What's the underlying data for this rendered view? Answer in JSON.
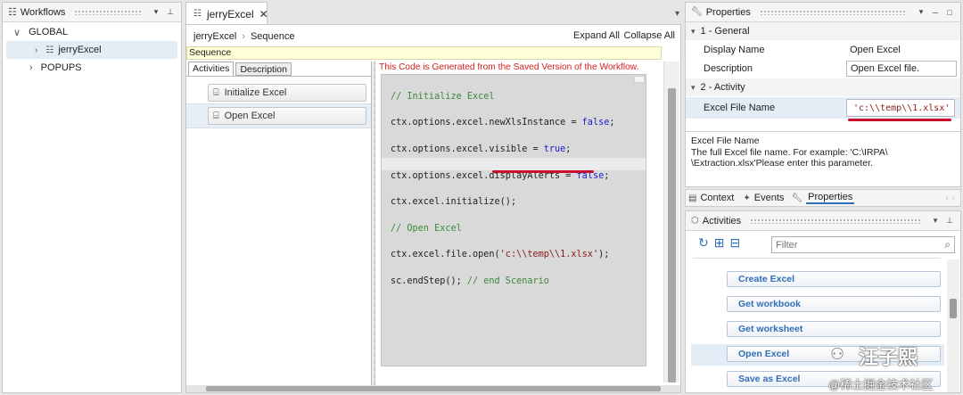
{
  "workflows": {
    "title": "Workflows",
    "items": [
      {
        "label": "GLOBAL"
      },
      {
        "label": "jerryExcel"
      },
      {
        "label": "POPUPS"
      }
    ]
  },
  "editor": {
    "tab_label": "jerryExcel",
    "breadcrumb": {
      "root": "jerryExcel",
      "child": "Sequence"
    },
    "expand_all": "Expand All",
    "collapse_all": "Collapse All",
    "sequence_label": "Sequence",
    "tabs": [
      "Activities",
      "Description"
    ],
    "activities": [
      "Initialize Excel",
      "Open Excel"
    ],
    "code_banner": "This Code is Generated from the Saved Version of the Workflow.",
    "code": {
      "l1": "// Initialize Excel",
      "l2a": "ctx.options.excel.newXlsInstance = ",
      "l2b": "false",
      "l3a": "ctx.options.excel.visible = ",
      "l3b": "true",
      "l4a": "ctx.options.excel.displayAlerts = ",
      "l4b": "false",
      "l5": "ctx.excel.initialize();",
      "l6": "// Open Excel",
      "l7a": "ctx.excel.file.open(",
      "l7b": "'c:\\\\temp\\\\1.xlsx'",
      "l7c": ");",
      "l8a": "sc.endStep(); ",
      "l8b": "// end Scenario"
    },
    "semicolon": ";"
  },
  "properties": {
    "title": "Properties",
    "sections": [
      {
        "label": "1 - General"
      },
      {
        "label": "2 - Activity"
      }
    ],
    "display_name_label": "Display Name",
    "display_name_value": "Open Excel",
    "description_label": "Description",
    "description_value": "Open Excel file.",
    "excel_file_name_label": "Excel File Name",
    "excel_file_name_value": "'c:\\\\temp\\\\1.xlsx'",
    "help_title": "Excel File Name",
    "help_text_1": "The full Excel file name. For example: 'C:\\IRPA\\",
    "help_text_2": "\\Extraction.xlsx'Please enter this parameter."
  },
  "bottom_tabs": {
    "context": "Context",
    "events": "Events",
    "properties": "Properties"
  },
  "activities_panel": {
    "title": "Activities",
    "filter_placeholder": "Filter",
    "items": [
      {
        "label": "Create Excel"
      },
      {
        "label": "Get workbook"
      },
      {
        "label": "Get worksheet"
      },
      {
        "label": "Open Excel"
      },
      {
        "label": "Save as Excel"
      }
    ]
  },
  "watermark": {
    "name": "汪子熙",
    "site": "@稀土掘金技术社区"
  },
  "colors": {
    "accent": "#2f6fb7",
    "underline": "#c8102e",
    "banner_text": "#d81e1e",
    "code_bg": "#d9d9d9"
  }
}
